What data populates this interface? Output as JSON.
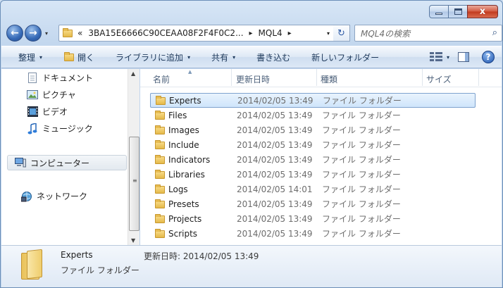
{
  "window": {
    "caption": {
      "minimize": "–",
      "maximize": "",
      "close": "x"
    }
  },
  "nav": {
    "back": "←",
    "forward": "→",
    "dropdown": "▾"
  },
  "address": {
    "prefix": "«",
    "segments": [
      "3BA15E6666C90CEAA08F2F4F0C2...",
      "MQL4"
    ],
    "separator": "▸",
    "dropdown": "▾",
    "refresh": "↻"
  },
  "search": {
    "placeholder": "MQL4の検索",
    "icon": "⌕"
  },
  "toolbar": {
    "organize": "整理",
    "open": "開く",
    "include_library": "ライブラリに追加",
    "share": "共有",
    "burn": "書き込む",
    "new_folder": "新しいフォルダー",
    "caret": "▾",
    "help": "?"
  },
  "sidebar": {
    "items": [
      {
        "label": "ドキュメント",
        "icon": "document-icon"
      },
      {
        "label": "ピクチャ",
        "icon": "pictures-icon"
      },
      {
        "label": "ビデオ",
        "icon": "video-icon"
      },
      {
        "label": "ミュージック",
        "icon": "music-icon"
      },
      {
        "label": "コンピューター",
        "icon": "computer-icon"
      },
      {
        "label": "ネットワーク",
        "icon": "network-icon"
      }
    ]
  },
  "columns": {
    "name": "名前",
    "modified": "更新日時",
    "type": "種類",
    "size": "サイズ"
  },
  "files": [
    {
      "name": "Experts",
      "modified": "2014/02/05 13:49",
      "type": "ファイル フォルダー"
    },
    {
      "name": "Files",
      "modified": "2014/02/05 13:49",
      "type": "ファイル フォルダー"
    },
    {
      "name": "Images",
      "modified": "2014/02/05 13:49",
      "type": "ファイル フォルダー"
    },
    {
      "name": "Include",
      "modified": "2014/02/05 13:49",
      "type": "ファイル フォルダー"
    },
    {
      "name": "Indicators",
      "modified": "2014/02/05 13:49",
      "type": "ファイル フォルダー"
    },
    {
      "name": "Libraries",
      "modified": "2014/02/05 13:49",
      "type": "ファイル フォルダー"
    },
    {
      "name": "Logs",
      "modified": "2014/02/05 14:01",
      "type": "ファイル フォルダー"
    },
    {
      "name": "Presets",
      "modified": "2014/02/05 13:49",
      "type": "ファイル フォルダー"
    },
    {
      "name": "Projects",
      "modified": "2014/02/05 13:49",
      "type": "ファイル フォルダー"
    },
    {
      "name": "Scripts",
      "modified": "2014/02/05 13:49",
      "type": "ファイル フォルダー"
    }
  ],
  "details": {
    "name": "Experts",
    "type": "ファイル フォルダー",
    "modified_label": "更新日時:",
    "modified": "2014/02/05 13:49"
  }
}
